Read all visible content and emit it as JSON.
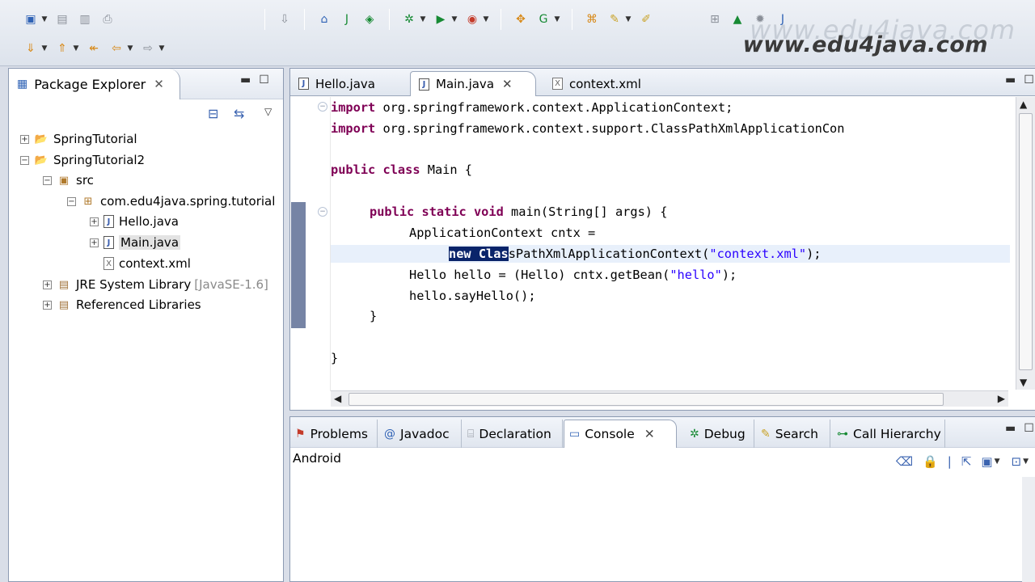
{
  "watermark": "www.edu4java.com",
  "package_explorer": {
    "title": "Package Explorer",
    "tree": [
      {
        "label": "SpringTutorial"
      },
      {
        "label": "SpringTutorial2"
      },
      {
        "label": "src"
      },
      {
        "label": "com.edu4java.spring.tutorial"
      },
      {
        "label": "Hello.java"
      },
      {
        "label": "Main.java"
      },
      {
        "label": "context.xml"
      },
      {
        "label": "JRE System Library",
        "suffix": "[JavaSE-1.6]"
      },
      {
        "label": "Referenced Libraries"
      }
    ]
  },
  "editor": {
    "tabs": [
      {
        "label": "Hello.java"
      },
      {
        "label": "Main.java"
      },
      {
        "label": "context.xml"
      }
    ],
    "code": {
      "l1_kw": "import",
      "l1_rest": " org.springframework.context.ApplicationContext;",
      "l2_kw": "import",
      "l2_rest": " org.springframework.context.support.ClassPathXmlApplicationCon",
      "l3_kw1": "public",
      "l3_kw2": "class",
      "l3_rest": " Main {",
      "l4_kw1": "public",
      "l4_kw2": "static",
      "l4_kw3": "void",
      "l4_rest": " main(String[] args) {",
      "l5": "ApplicationContext cntx =",
      "l6_sel": "new Clas",
      "l6_rest": "sPathXmlApplicationContext(",
      "l6_str": "\"context.xml\"",
      "l6_end": ");",
      "l7_a": "Hello hello = (Hello) cntx.getBean(",
      "l7_str": "\"hello\"",
      "l7_end": ");",
      "l8": "hello.sayHello();",
      "l9": "}",
      "l10": "}"
    }
  },
  "bottom": {
    "tabs": [
      {
        "label": "Problems"
      },
      {
        "label": "Javadoc"
      },
      {
        "label": "Declaration"
      },
      {
        "label": "Console"
      },
      {
        "label": "Debug"
      },
      {
        "label": "Search"
      },
      {
        "label": "Call Hierarchy"
      }
    ],
    "console_label": "Android"
  }
}
